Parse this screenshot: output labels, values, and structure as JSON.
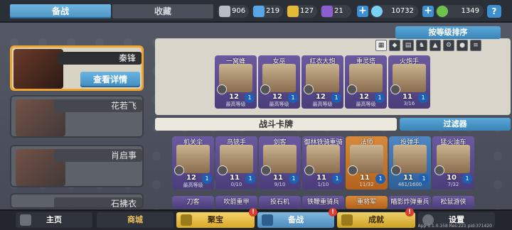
{
  "tabs": {
    "active": "备战",
    "inactive": "收藏"
  },
  "resources": [
    {
      "name": "silver-shield",
      "value": "906",
      "color": "#b9bcc2"
    },
    {
      "name": "blue-shield",
      "value": "219",
      "color": "#58a6e6"
    },
    {
      "name": "gold-shield",
      "value": "127",
      "color": "#e5b93a"
    },
    {
      "name": "purple-shield",
      "value": "21",
      "color": "#8c5fd1"
    }
  ],
  "gems": "10732",
  "coins": "1349",
  "help": "?",
  "heroes": [
    {
      "name": "秦锋",
      "detail_label": "查看详情"
    },
    {
      "name": "花若飞"
    },
    {
      "name": "肖启事"
    },
    {
      "name": "石拂衣"
    }
  ],
  "sort_label": "按等级排序",
  "collection_cards": [
    {
      "title": "一窝蜂",
      "level": "12",
      "cost": "1",
      "tag": "最高等级",
      "color": "purple"
    },
    {
      "title": "女巫",
      "level": "12",
      "cost": "1",
      "tag": "最高等级",
      "color": "purple"
    },
    {
      "title": "红衣大炮",
      "level": "12",
      "cost": "1",
      "tag": "最高等级",
      "color": "purple"
    },
    {
      "title": "重灵塔",
      "level": "12",
      "cost": "1",
      "tag": "最高等级",
      "color": "purple"
    },
    {
      "title": "火炮手",
      "level": "11",
      "cost": "1",
      "tag": "3/16",
      "color": "purple"
    }
  ],
  "deck_label": "战斗卡牌",
  "filter_label": "过滤器",
  "deck_cards": [
    {
      "title": "机关伞",
      "level": "12",
      "cost": "1",
      "tag": "最高等级",
      "color": "purple"
    },
    {
      "title": "鸟铳手",
      "level": "11",
      "cost": "1",
      "tag": "0/10",
      "color": "purple"
    },
    {
      "title": "剑客",
      "level": "11",
      "cost": "1",
      "tag": "9/10",
      "color": "purple"
    },
    {
      "title": "御林铁骑重骑兵",
      "level": "11",
      "cost": "1",
      "tag": "1/10",
      "color": "purple"
    },
    {
      "title": "法师",
      "level": "11",
      "cost": "1",
      "tag": "11/32",
      "color": "orange"
    },
    {
      "title": "投弹手",
      "level": "11",
      "cost": "1",
      "tag": "461/1600",
      "color": "blue"
    },
    {
      "title": "猛火油车",
      "level": "10",
      "cost": "1",
      "tag": "7/32",
      "color": "purple"
    }
  ],
  "deck_row2_titles": [
    "刀客",
    "吹箭重甲",
    "投石机",
    "铁鞭重骑兵",
    "重将军",
    "瞄影炸弹重兵",
    "松鼠游侠"
  ],
  "nav": {
    "home": "主页",
    "shop": "商城",
    "treasure": "聚宝",
    "battle": "备战",
    "achieve": "成就",
    "settings": "设置",
    "badge": "!"
  },
  "version": "App 1.1.0.158 Res:221 pid:371420"
}
